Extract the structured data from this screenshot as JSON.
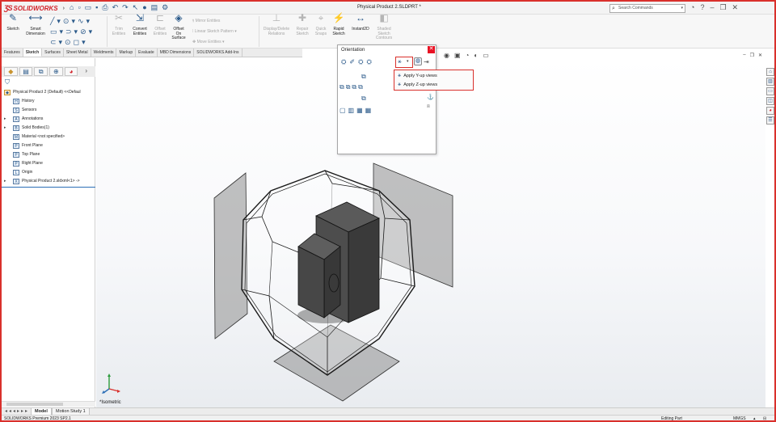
{
  "app": {
    "brand": "SOLIDWORKS",
    "document_title": "Physical Product 2.SLDPRT *"
  },
  "search": {
    "placeholder": "Search Commands"
  },
  "ribbon": {
    "sketch": "Sketch",
    "smart_dimension_1": "Smart",
    "smart_dimension_2": "Dimension",
    "trim_1": "Trim",
    "trim_2": "Entities",
    "convert_1": "Convert",
    "convert_2": "Entities",
    "offset_1": "Offset",
    "offset_2": "Entities",
    "offset_surface_1": "Offset",
    "offset_surface_2": "On",
    "offset_surface_3": "Surface",
    "mirror_entities": "Mirror Entities",
    "linear_pattern": "Linear Sketch Pattern",
    "move_entities": "Move Entities",
    "display_delete_1": "Display/Delete",
    "display_delete_2": "Relations",
    "repair_1": "Repair",
    "repair_2": "Sketch",
    "quick_snaps_1": "Quick",
    "quick_snaps_2": "Snaps",
    "rapid_1": "Rapid",
    "rapid_2": "Sketch",
    "instant2d": "Instant2D",
    "shaded_1": "Shaded",
    "shaded_2": "Sketch",
    "shaded_3": "Contours"
  },
  "command_tabs": [
    "Features",
    "Sketch",
    "Surfaces",
    "Sheet Metal",
    "Weldments",
    "Markup",
    "Evaluate",
    "MBD Dimensions",
    "SOLIDWORKS Add-Ins"
  ],
  "active_command_tab": "Sketch",
  "tree": {
    "root": "Physical Product 2 (Default) <<Defaul",
    "items": [
      {
        "label": "History",
        "icon": "H"
      },
      {
        "label": "Sensors",
        "icon": "S"
      },
      {
        "label": "Annotations",
        "icon": "A"
      },
      {
        "label": "Solid Bodies(1)",
        "icon": "B"
      },
      {
        "label": "Material <not specified>",
        "icon": "M"
      },
      {
        "label": "Front Plane",
        "icon": "P"
      },
      {
        "label": "Top Plane",
        "icon": "P"
      },
      {
        "label": "Right Plane",
        "icon": "P"
      },
      {
        "label": "Origin",
        "icon": "L"
      },
      {
        "label": "Physical Product 2.sldxml<1> ->",
        "icon": "X"
      }
    ]
  },
  "orientation": {
    "title": "Orientation",
    "menu": {
      "y_up": "Apply Y-up views",
      "z_up": "Apply Z-up views"
    }
  },
  "viewport": {
    "view_label": "*Isometric"
  },
  "bottom_tabs": [
    "Model",
    "Motion Study 1"
  ],
  "status": {
    "product": "SOLIDWORKS Premium 2023 SP2.1",
    "mode": "Editing Part",
    "units": "MMGS"
  },
  "colors": {
    "accent": "#d9302c",
    "brand_red": "#d2232a",
    "icon_blue": "#2b5a8a"
  }
}
